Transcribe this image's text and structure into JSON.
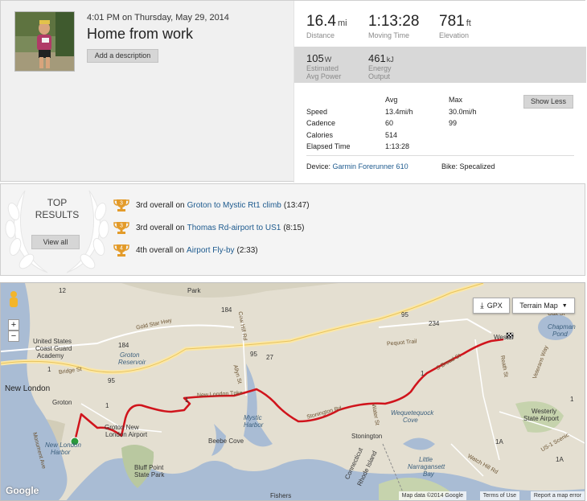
{
  "activity": {
    "datetime": "4:01 PM on Thursday, May 29, 2014",
    "title": "Home from work",
    "add_description_label": "Add a description"
  },
  "stats": {
    "distance": {
      "value": "16.4",
      "unit": "mi",
      "label": "Distance"
    },
    "moving_time": {
      "value": "1:13:28",
      "label": "Moving Time"
    },
    "elevation": {
      "value": "781",
      "unit": "ft",
      "label": "Elevation"
    },
    "avg_power": {
      "value": "105",
      "unit": "W",
      "label_line1": "Estimated",
      "label_line2": "Avg Power"
    },
    "energy": {
      "value": "461",
      "unit": "kJ",
      "label_line1": "Energy",
      "label_line2": "Output"
    }
  },
  "details": {
    "col_avg": "Avg",
    "col_max": "Max",
    "rows": [
      {
        "label": "Speed",
        "avg": "13.4mi/h",
        "max": "30.0mi/h"
      },
      {
        "label": "Cadence",
        "avg": "60",
        "max": "99"
      },
      {
        "label": "Calories",
        "avg": "514",
        "max": ""
      },
      {
        "label": "Elapsed Time",
        "avg": "1:13:28",
        "max": ""
      }
    ],
    "show_less_label": "Show Less",
    "device_label": "Device:",
    "device_name": "Garmin Forerunner 610",
    "bike_text": "Bike: Specalized"
  },
  "top_results": {
    "title_line1": "TOP",
    "title_line2": "RESULTS",
    "view_all_label": "View all",
    "items": [
      {
        "rank": "3",
        "prefix": "3rd overall on",
        "segment": "Groton to Mystic Rt1 climb",
        "time": "(13:47)"
      },
      {
        "rank": "3",
        "prefix": "3rd overall on",
        "segment": "Thomas Rd-airport to US1",
        "time": "(8:15)"
      },
      {
        "rank": "4",
        "prefix": "4th overall on",
        "segment": "Airport Fly-by",
        "time": "(2:33)"
      }
    ]
  },
  "map": {
    "gpx_label": "GPX",
    "map_type_label": "Terrain Map",
    "zoom_in": "+",
    "zoom_out": "−",
    "google_logo": "Google",
    "attribution": "Map data ©2014 Google",
    "terms": "Terms of Use",
    "report": "Report a map error",
    "labels": {
      "park": "Park",
      "usa": "United States",
      "coast_guard": "Coast Guard",
      "academy": "Academy",
      "new_london": "New London",
      "groton": "Groton",
      "groton_reservoir_1": "Groton",
      "groton_reservoir_2": "Reservoir",
      "groton_airport_1": "Groton New",
      "groton_airport_2": "London Airport",
      "new_london_harbor_1": "New London",
      "new_london_harbor_2": "Harbor",
      "beebe_cove": "Beebe Cove",
      "bluff_point_1": "Bluff Point",
      "bluff_point_2": "State Park",
      "mystic_harbor_1": "Mystic",
      "mystic_harbor_2": "Harbor",
      "stonington": "Stonington",
      "weq_cove_1": "Wequetequock",
      "weq_cove_2": "Cove",
      "little_narr_1": "Little",
      "little_narr_2": "Narragansett",
      "little_narr_3": "Bay",
      "westerly_1": "Westerly",
      "westerly_2": "State Airport",
      "westerly": "Wester",
      "chapman_1": "Chapman",
      "chapman_2": "Pond",
      "fishers": "Fishers",
      "ct_ri_1": "Connecticut",
      "ct_ri_2": "Rhode Island",
      "gold_star": "Gold Star Hwy",
      "bridge_st": "Bridge St",
      "pequot_trail": "Pequot Trail",
      "new_london_tpke": "New London Tpke",
      "stonington_rd": "Stonington Rd",
      "s_broad_st": "S Broad St",
      "cow_hill": "Cow Hill Rd",
      "allyn_st": "Allyn St",
      "reath_st": "Reath St",
      "veterans_way": "Veterans Way",
      "oak_st": "Oak St",
      "monument_ave": "Monument Ave",
      "us1_scenic": "US-1 Scenic",
      "watch_hill": "Watch Hill Rd",
      "water_st": "Water St",
      "rt12": "12",
      "rt184a": "184",
      "rt184b": "184",
      "rt95a": "95",
      "rt95b": "95",
      "rt95c": "95",
      "rt1a": "1",
      "rt1b": "1",
      "rt1c": "1",
      "rt1d": "1",
      "rt1e": "1",
      "rt27": "27",
      "rt234": "234",
      "rt1a_e": "1A",
      "rt1a_f": "1A"
    }
  },
  "colors": {
    "accent_link": "#1d5a8e",
    "route": "#d0141c",
    "trophy": "#e39b2a"
  }
}
